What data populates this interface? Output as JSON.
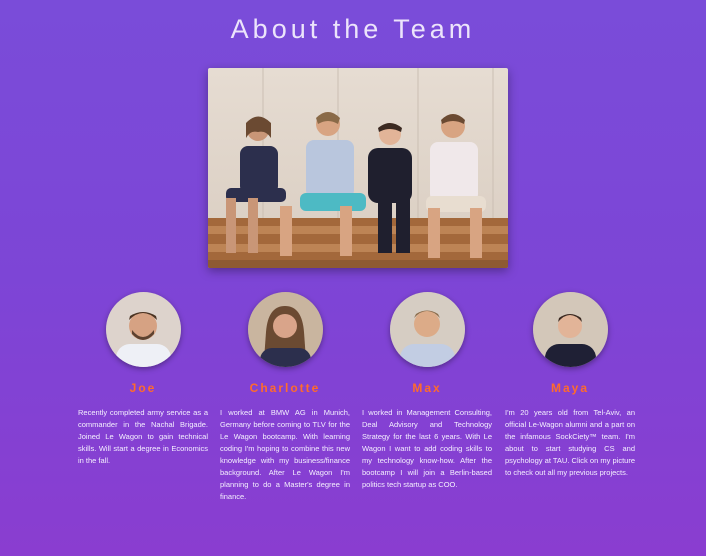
{
  "page": {
    "title": "About the Team"
  },
  "team_photo": {
    "alt": "Team photo of four members sitting on wooden pallets"
  },
  "members": [
    {
      "name": "Joe",
      "bio": "Recently completed army service as a commander in the Nachal Brigade. Joined Le Wagon to gain technical skills. Will start a degree in Economics in the fall."
    },
    {
      "name": "Charlotte",
      "bio": "I worked at BMW AG in Munich, Germany before coming to TLV for the Le Wagon bootcamp. With learning coding I'm hoping to combine this new knowledge with my business/finance background. After Le Wagon I'm planning to do a Master's degree in finance."
    },
    {
      "name": "Max",
      "bio": "I worked in Management Consulting, Deal Advisory and Technology Strategy for the last 6 years. With Le Wagon I want to add coding skills to my technology know-how. After the bootcamp I will join a Berlin-based politics tech startup as COO."
    },
    {
      "name": "Maya",
      "bio": "I'm 20 years old from Tel-Aviv, an official Le-Wagon alumni and a part on the infamous SockCiety™ team. I'm about to start studying CS and psychology at TAU. Click on my picture to check out all my previous projects."
    }
  ],
  "colors": {
    "accent": "#ff6b2c",
    "background_top": "#7a4cd9",
    "background_bottom": "#8a3dd0"
  }
}
